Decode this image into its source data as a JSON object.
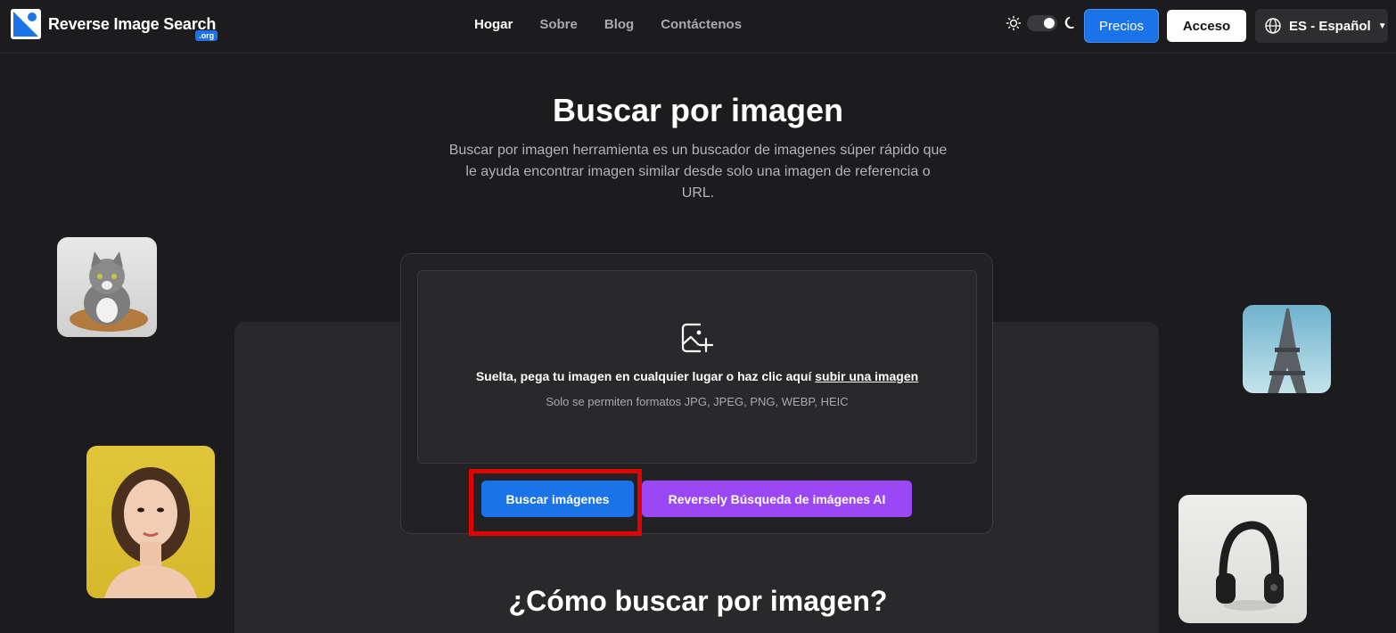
{
  "header": {
    "logo_text": "Reverse Image Search",
    "logo_sub": ".org",
    "nav": [
      {
        "label": "Hogar",
        "active": true
      },
      {
        "label": "Sobre",
        "active": false
      },
      {
        "label": "Blog",
        "active": false
      },
      {
        "label": "Contáctenos",
        "active": false
      }
    ],
    "theme_icons": [
      "sun-icon",
      "moon-icon"
    ],
    "theme_mode": "dark",
    "precios_label": "Precios",
    "acceso_label": "Acceso",
    "language_label": "ES - Español"
  },
  "hero": {
    "title": "Buscar por imagen",
    "description": "Buscar por imagen herramienta es un buscador de imagenes súper rápido que le ayuda encontrar imagen similar desde solo una imagen de referencia o URL."
  },
  "upload": {
    "drop_text": "Suelta, pega tu imagen en cualquier lugar o haz clic aquí",
    "drop_link": "subir una imagen",
    "formats_text": "Solo se permiten formatos JPG, JPEG, PNG, WEBP, HEIC",
    "search_button": "Buscar imágenes",
    "ai_button": "Reversely Búsqueda de imágenes AI"
  },
  "how_title": "¿Cómo buscar por imagen?",
  "colors": {
    "accent_blue": "#1a73e8",
    "accent_purple": "#9c47f5",
    "highlight_red": "#e30000",
    "background": "#1c1c1e"
  }
}
